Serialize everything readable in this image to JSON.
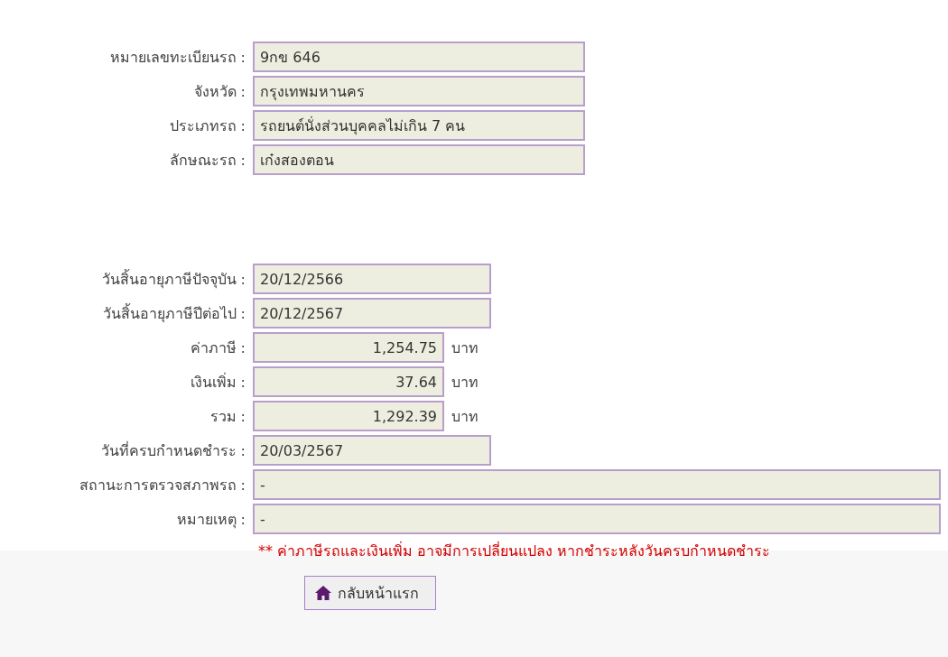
{
  "vehicle": [
    {
      "label": "หมายเลขทะเบียนรถ :",
      "value": "9กข 646",
      "kind": "text"
    },
    {
      "label": "จังหวัด :",
      "value": "กรุงเทพมหานคร",
      "kind": "text"
    },
    {
      "label": "ประเภทรถ :",
      "value": "รถยนต์นั่งส่วนบุคคลไม่เกิน 7 คน",
      "kind": "text"
    },
    {
      "label": "ลักษณะรถ :",
      "value": "เก๋งสองตอน",
      "kind": "text"
    }
  ],
  "tax": [
    {
      "label": "วันสิ้นอายุภาษีปัจจุบัน :",
      "value": "20/12/2566",
      "kind": "date"
    },
    {
      "label": "วันสิ้นอายุภาษีปีต่อไป :",
      "value": "20/12/2567",
      "kind": "date"
    },
    {
      "label": "ค่าภาษี :",
      "value": "1,254.75",
      "kind": "money",
      "unit": "บาท"
    },
    {
      "label": "เงินเพิ่ม :",
      "value": "37.64",
      "kind": "money",
      "unit": "บาท"
    },
    {
      "label": "รวม :",
      "value": "1,292.39",
      "kind": "money",
      "unit": "บาท"
    },
    {
      "label": "วันที่ครบกำหนดชำระ :",
      "value": "20/03/2567",
      "kind": "date"
    },
    {
      "label": "สถานะการตรวจสภาพรถ :",
      "value": "-",
      "kind": "full"
    },
    {
      "label": "หมายเหตุ :",
      "value": "-",
      "kind": "full"
    }
  ],
  "note": "** ค่าภาษีรถและเงินเพิ่ม อาจมีการเปลี่ยนแปลง หากชำระหลังวันครบกำหนดชำระ",
  "back_button": "กลับหน้าแรก"
}
